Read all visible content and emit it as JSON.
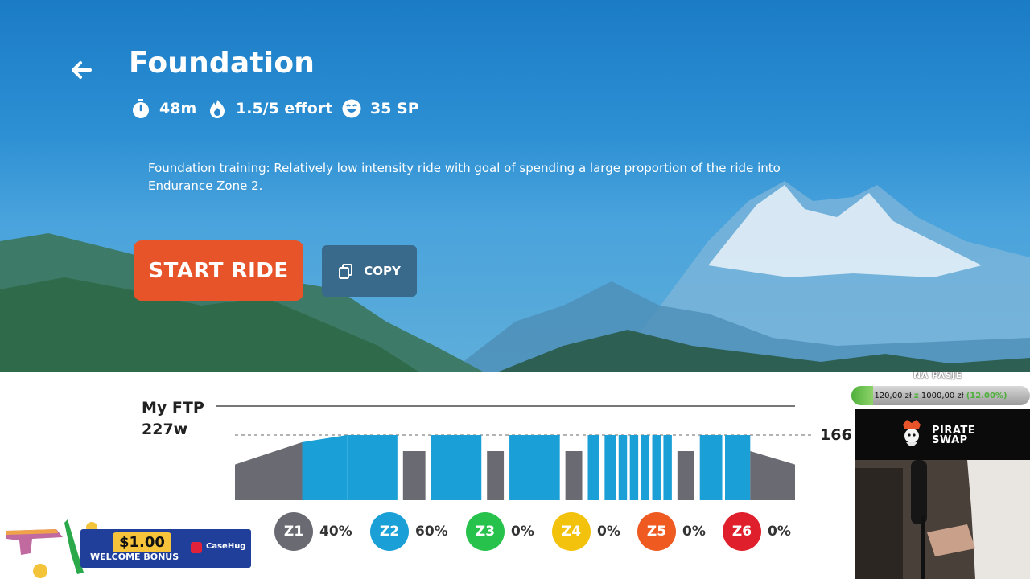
{
  "workout": {
    "title": "Foundation",
    "duration": "48m",
    "effort": "1.5/5 effort",
    "points": "35 SP",
    "description": "Foundation training: Relatively low intensity ride with goal of spending a large proportion of the ride into Endurance Zone 2.",
    "start_label": "START RIDE",
    "copy_label": "COPY"
  },
  "icons": {
    "back": "arrow-left-icon",
    "duration": "stopwatch-icon",
    "effort": "flame-icon",
    "points": "smiley-icon",
    "copy": "copy-icon"
  },
  "ftp": {
    "label_line1": "My FTP",
    "label_line2": "227w",
    "target_value": "166"
  },
  "zones": [
    {
      "id": "Z1",
      "percent": "40%",
      "color": "#6a6a72"
    },
    {
      "id": "Z2",
      "percent": "60%",
      "color": "#1aa0d6"
    },
    {
      "id": "Z3",
      "percent": "0%",
      "color": "#27c24c"
    },
    {
      "id": "Z4",
      "percent": "0%",
      "color": "#f2c20c"
    },
    {
      "id": "Z5",
      "percent": "0%",
      "color": "#ee5a1f"
    },
    {
      "id": "Z6",
      "percent": "0%",
      "color": "#e01f2d"
    }
  ],
  "chart_data": {
    "type": "area",
    "title": "",
    "xlabel": "",
    "ylabel": "",
    "reference_lines": [
      {
        "label": "My FTP 227w",
        "value": 227
      },
      {
        "label": "166",
        "value": 166
      }
    ],
    "segments": [
      {
        "zone": "Z1",
        "start": 0.0,
        "end": 0.12,
        "from": 0.4,
        "to": 0.65
      },
      {
        "zone": "Z2",
        "start": 0.12,
        "end": 0.2,
        "from": 0.65,
        "to": 0.73
      },
      {
        "zone": "Z2",
        "start": 0.2,
        "end": 0.29,
        "from": 0.73,
        "to": 0.73
      },
      {
        "zone": "Z1",
        "start": 0.3,
        "end": 0.34,
        "from": 0.55,
        "to": 0.55
      },
      {
        "zone": "Z2",
        "start": 0.35,
        "end": 0.44,
        "from": 0.73,
        "to": 0.73
      },
      {
        "zone": "Z1",
        "start": 0.45,
        "end": 0.48,
        "from": 0.55,
        "to": 0.55
      },
      {
        "zone": "Z2",
        "start": 0.49,
        "end": 0.58,
        "from": 0.73,
        "to": 0.73
      },
      {
        "zone": "Z1",
        "start": 0.59,
        "end": 0.62,
        "from": 0.55,
        "to": 0.55
      },
      {
        "zone": "Z2",
        "start": 0.63,
        "end": 0.65,
        "from": 0.73,
        "to": 0.73
      },
      {
        "zone": "Z2",
        "start": 0.66,
        "end": 0.68,
        "from": 0.73,
        "to": 0.73
      },
      {
        "zone": "Z2",
        "start": 0.685,
        "end": 0.7,
        "from": 0.73,
        "to": 0.73
      },
      {
        "zone": "Z2",
        "start": 0.705,
        "end": 0.72,
        "from": 0.73,
        "to": 0.73
      },
      {
        "zone": "Z2",
        "start": 0.725,
        "end": 0.74,
        "from": 0.73,
        "to": 0.73
      },
      {
        "zone": "Z2",
        "start": 0.745,
        "end": 0.76,
        "from": 0.73,
        "to": 0.73
      },
      {
        "zone": "Z2",
        "start": 0.765,
        "end": 0.78,
        "from": 0.73,
        "to": 0.73
      },
      {
        "zone": "Z1",
        "start": 0.79,
        "end": 0.82,
        "from": 0.55,
        "to": 0.55
      },
      {
        "zone": "Z2",
        "start": 0.83,
        "end": 0.87,
        "from": 0.73,
        "to": 0.73
      },
      {
        "zone": "Z2",
        "start": 0.875,
        "end": 0.92,
        "from": 0.73,
        "to": 0.73
      },
      {
        "zone": "Z1",
        "start": 0.92,
        "end": 1.0,
        "from": 0.55,
        "to": 0.4
      }
    ]
  },
  "overlays": {
    "ad_price": "$1.00",
    "ad_text": "WELCOME BONUS",
    "ad_brand": "CaseHug",
    "goal_title": "NA PASJE",
    "goal_current": "120,00 zł",
    "goal_separator": "z",
    "goal_target": "1000,00 zł",
    "goal_percent": "(12.00%)",
    "goal_fraction": 0.12,
    "sponsor_line1": "PIRATE",
    "sponsor_line2": "SWAP"
  }
}
